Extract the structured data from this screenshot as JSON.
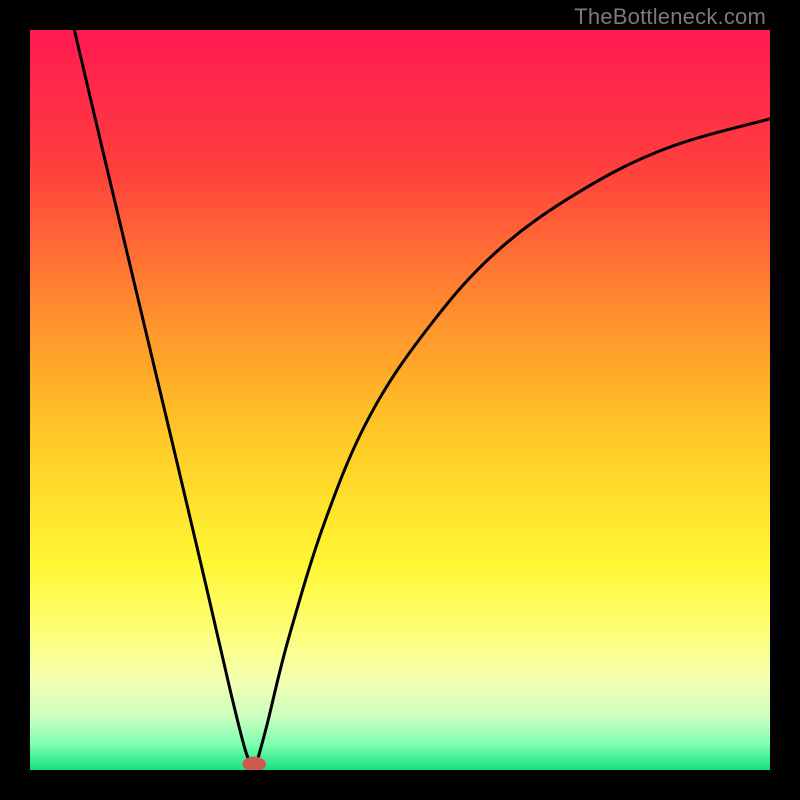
{
  "watermark": "TheBottleneck.com",
  "chart_data": {
    "type": "line",
    "title": "",
    "xlabel": "",
    "ylabel": "",
    "xlim": [
      0,
      100
    ],
    "ylim": [
      0,
      100
    ],
    "background_gradient": {
      "stops": [
        {
          "offset": 0.0,
          "color": "#ff1a52"
        },
        {
          "offset": 0.18,
          "color": "#ff3d3d"
        },
        {
          "offset": 0.38,
          "color": "#ff8d2e"
        },
        {
          "offset": 0.55,
          "color": "#ffc926"
        },
        {
          "offset": 0.72,
          "color": "#fff733"
        },
        {
          "offset": 0.82,
          "color": "#fdff7e"
        },
        {
          "offset": 0.88,
          "color": "#f3ffb3"
        },
        {
          "offset": 0.93,
          "color": "#c9ffbf"
        },
        {
          "offset": 0.965,
          "color": "#7dffb0"
        },
        {
          "offset": 1.0,
          "color": "#18e07d"
        }
      ]
    },
    "curve": {
      "description": "V-shaped curve with steep near-linear left branch and concave-right asymptotic right branch; minimum near x≈30",
      "min_x": 30,
      "left_branch": [
        {
          "x": 6.0,
          "y": 100.0
        },
        {
          "x": 10.0,
          "y": 83.0
        },
        {
          "x": 15.0,
          "y": 62.0
        },
        {
          "x": 20.0,
          "y": 41.0
        },
        {
          "x": 24.0,
          "y": 24.0
        },
        {
          "x": 27.0,
          "y": 11.0
        },
        {
          "x": 29.0,
          "y": 3.0
        },
        {
          "x": 30.0,
          "y": 0.5
        }
      ],
      "right_branch": [
        {
          "x": 30.5,
          "y": 0.5
        },
        {
          "x": 32.0,
          "y": 6.0
        },
        {
          "x": 35.0,
          "y": 18.0
        },
        {
          "x": 40.0,
          "y": 34.0
        },
        {
          "x": 46.0,
          "y": 48.0
        },
        {
          "x": 54.0,
          "y": 60.0
        },
        {
          "x": 63.0,
          "y": 70.0
        },
        {
          "x": 74.0,
          "y": 78.0
        },
        {
          "x": 86.0,
          "y": 84.0
        },
        {
          "x": 100.0,
          "y": 88.0
        }
      ]
    },
    "marker": {
      "x": 30.3,
      "y": 0.8,
      "rx": 1.6,
      "ry": 1.0,
      "color": "#cc5a4e"
    }
  }
}
